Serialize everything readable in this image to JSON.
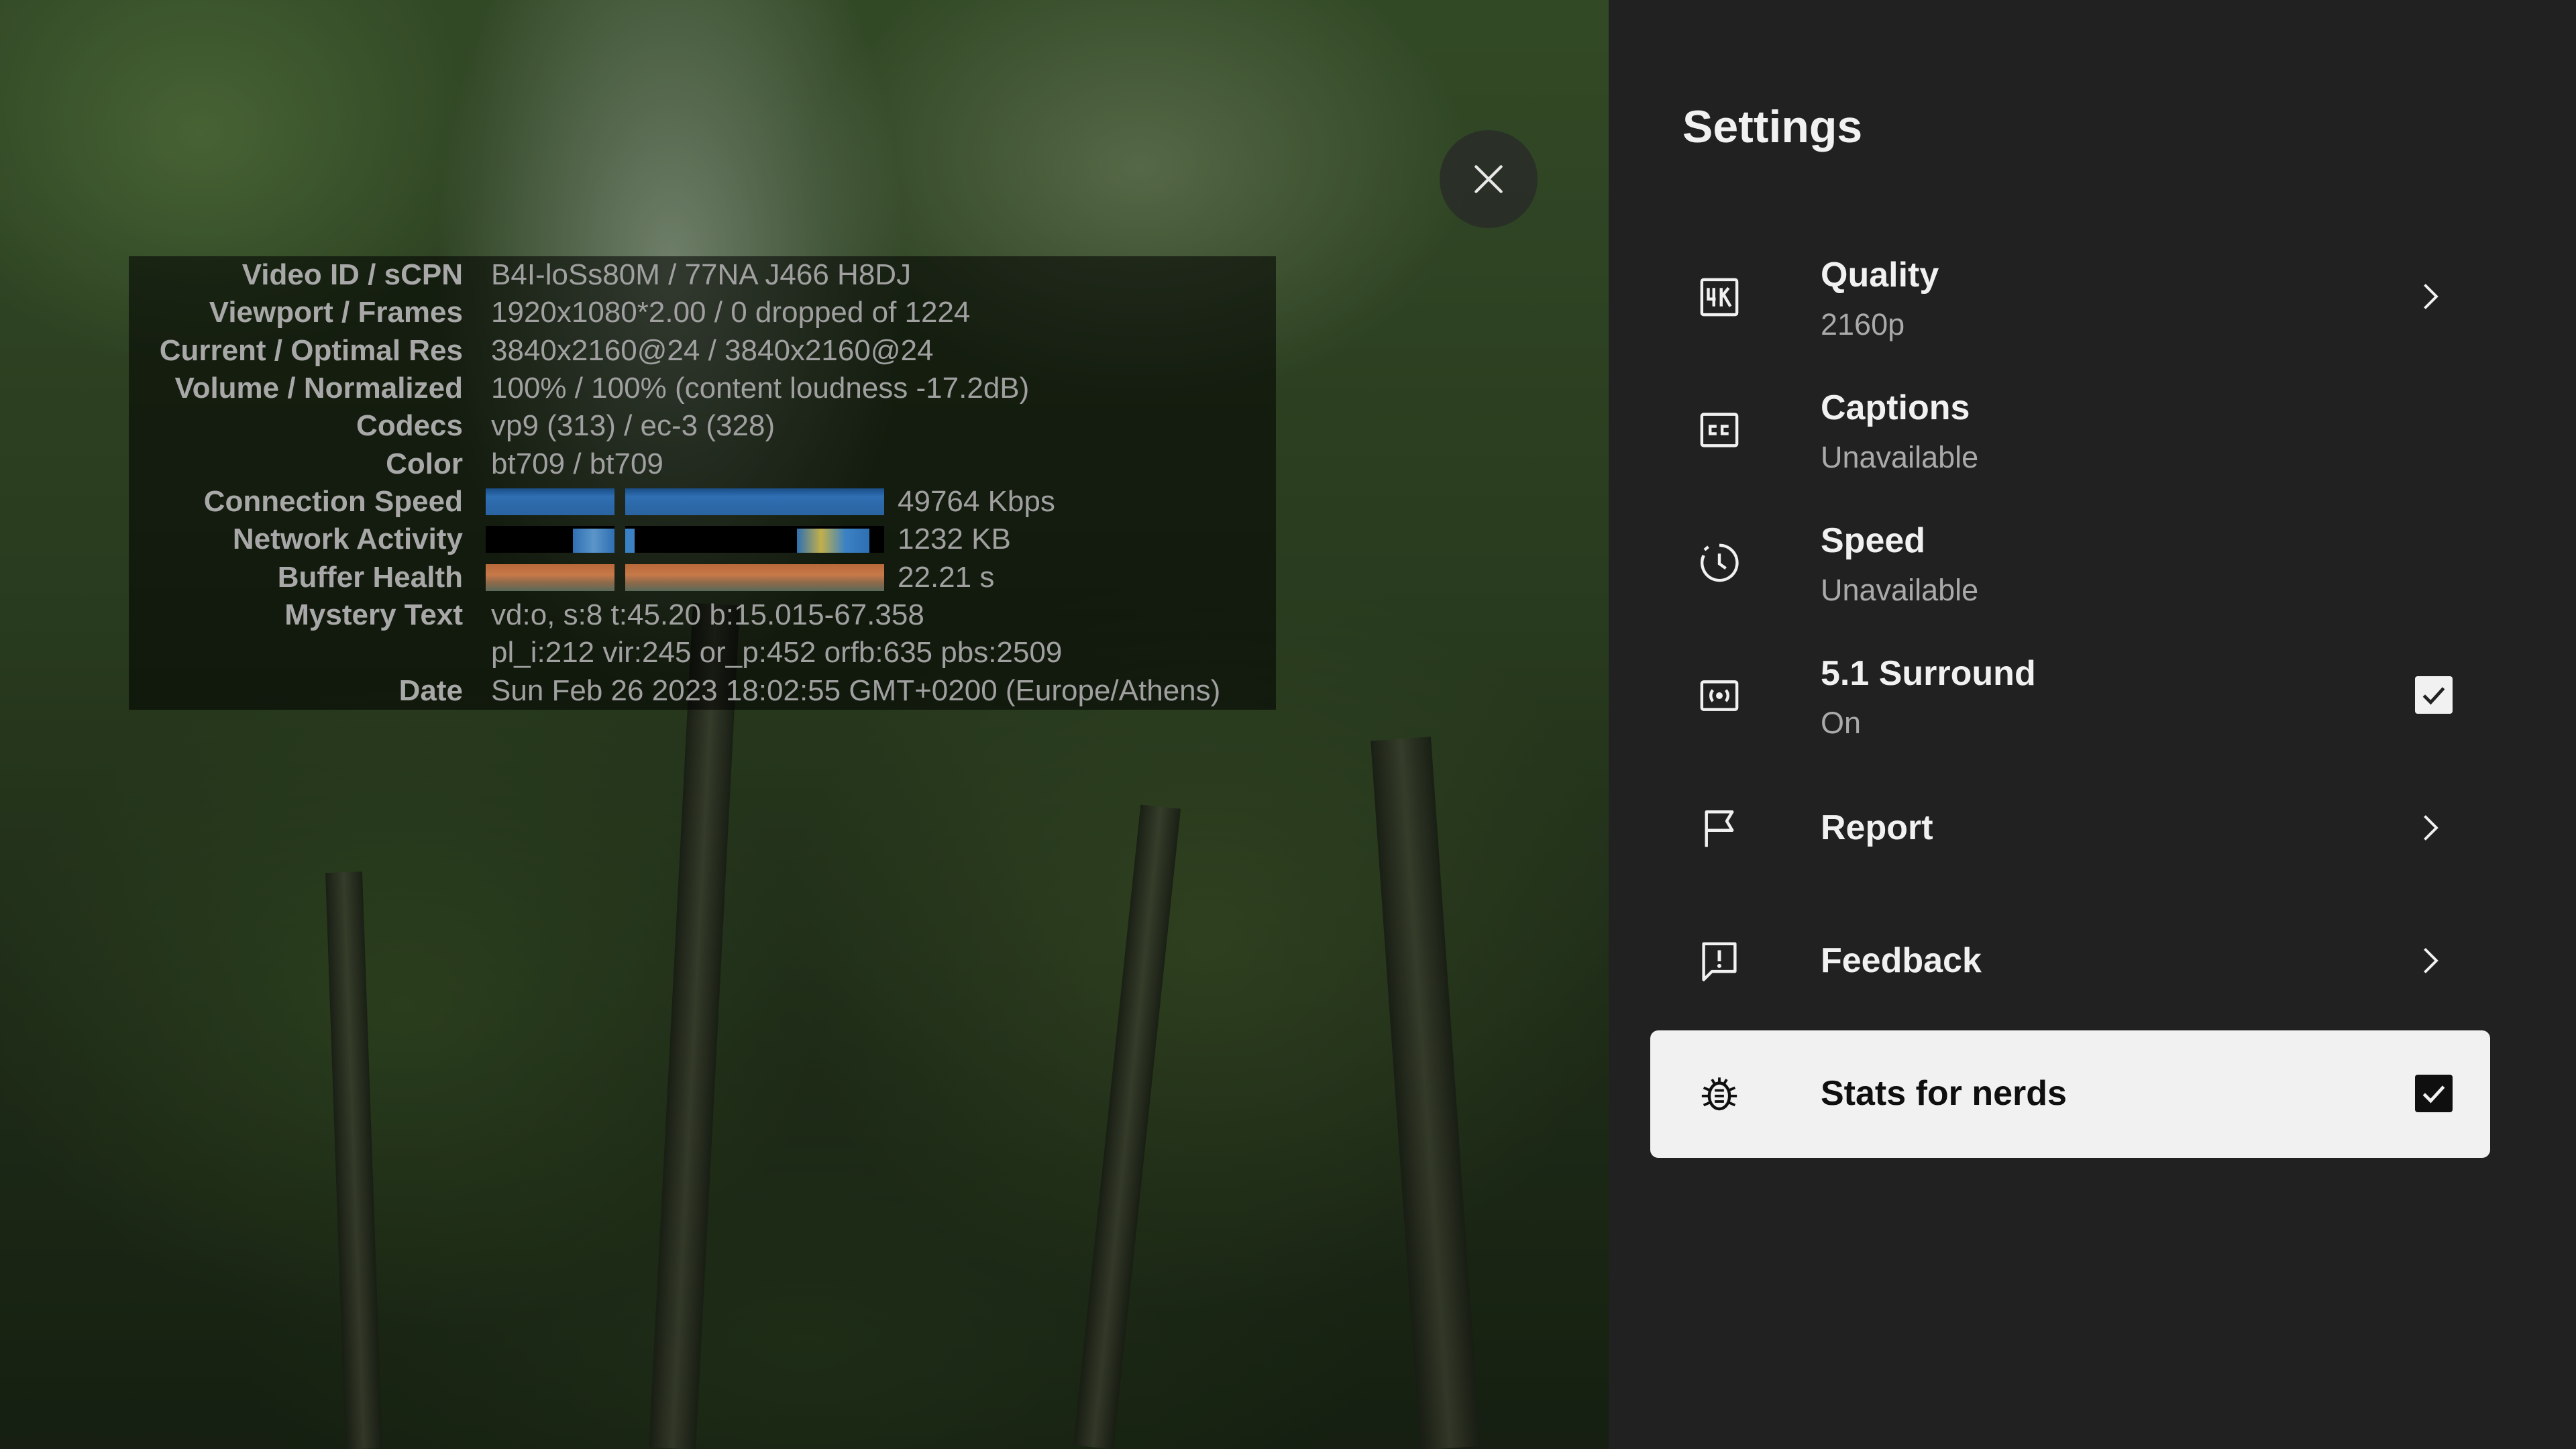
{
  "stats": {
    "rows": [
      {
        "label": "Video ID / sCPN",
        "value": "B4I-loSs80M / 77NA J466 H8DJ"
      },
      {
        "label": "Viewport / Frames",
        "value": "1920x1080*2.00 / 0 dropped of 1224"
      },
      {
        "label": "Current / Optimal Res",
        "value": "3840x2160@24 / 3840x2160@24"
      },
      {
        "label": "Volume / Normalized",
        "value": "100% / 100% (content loudness -17.2dB)"
      },
      {
        "label": "Codecs",
        "value": "vp9 (313) / ec-3 (328)"
      },
      {
        "label": "Color",
        "value": "bt709 / bt709"
      },
      {
        "label": "Connection Speed",
        "value": "49764 Kbps"
      },
      {
        "label": "Network Activity",
        "value": "1232 KB"
      },
      {
        "label": "Buffer Health",
        "value": "22.21 s"
      },
      {
        "label": "Mystery Text",
        "value": "vd:o, s:8 t:45.20 b:15.015-67.358"
      },
      {
        "label": "",
        "value": "pl_i:212 vir:245 or_p:452 orfb:635 pbs:2509"
      },
      {
        "label": "Date",
        "value": "Sun Feb 26 2023 18:02:55 GMT+0200 (Europe/Athens)"
      }
    ],
    "graph_colors": {
      "connection": "#2b6cb0",
      "network": "#000000",
      "network_bars": "#3b82c4",
      "buffer": "#c2703a"
    }
  },
  "close_icon": "close-icon",
  "settings": {
    "title": "Settings",
    "items": [
      {
        "title": "Quality",
        "subtitle": "2160p",
        "icon": "4k-icon",
        "action": "chevron"
      },
      {
        "title": "Captions",
        "subtitle": "Unavailable",
        "icon": "cc-icon",
        "action": "none"
      },
      {
        "title": "Speed",
        "subtitle": "Unavailable",
        "icon": "speed-icon",
        "action": "none"
      },
      {
        "title": "5.1 Surround",
        "subtitle": "On",
        "icon": "surround-icon",
        "action": "checkbox",
        "checked": true
      },
      {
        "title": "Report",
        "subtitle": "",
        "icon": "flag-icon",
        "action": "chevron"
      },
      {
        "title": "Feedback",
        "subtitle": "",
        "icon": "feedback-icon",
        "action": "chevron"
      },
      {
        "title": "Stats for nerds",
        "subtitle": "",
        "icon": "bug-icon",
        "action": "checkbox",
        "checked": true,
        "selected": true
      }
    ]
  }
}
